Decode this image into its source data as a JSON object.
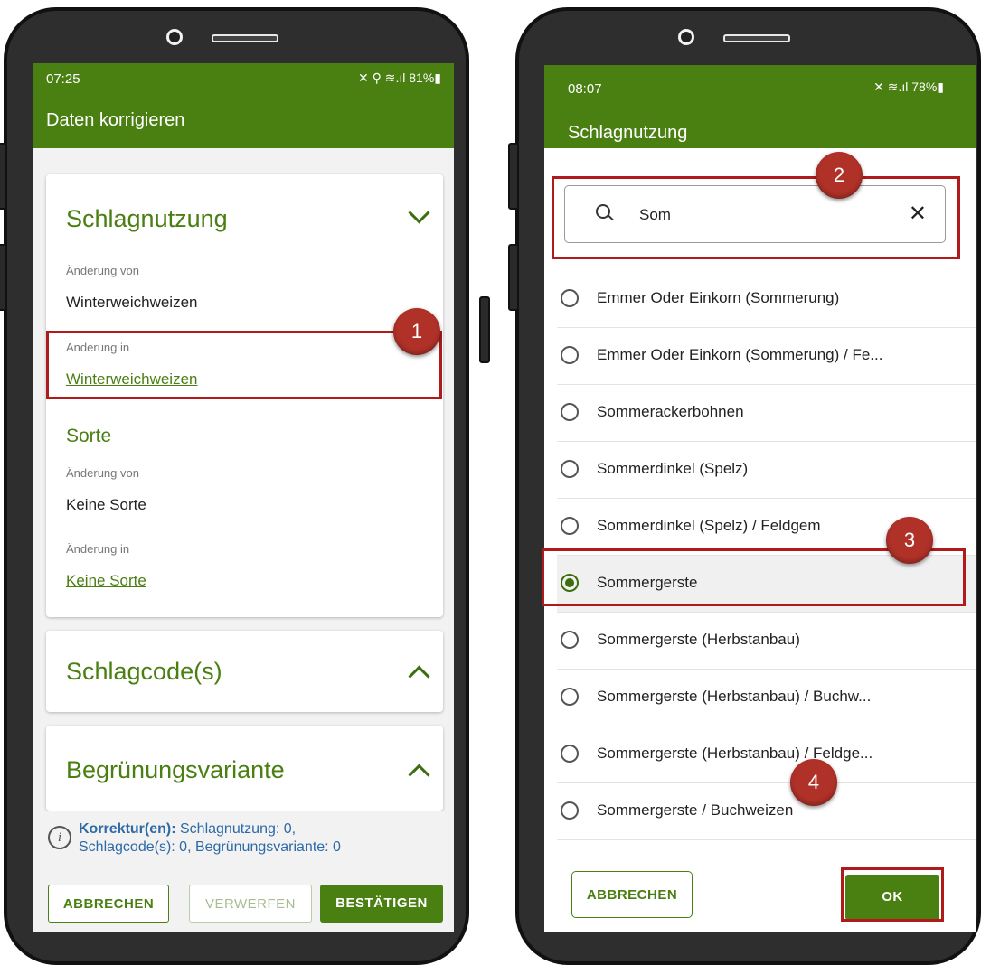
{
  "left_phone": {
    "status": {
      "time": "07:25",
      "icons": "✕ ⚲ ≋.ıl 81%▮"
    },
    "app_title": "Daten korrigieren",
    "card_schlagnutzung": {
      "title": "Schlagnutzung",
      "from_label": "Änderung von",
      "from_value": "Winterweichweizen",
      "to_label": "Änderung in",
      "to_value": "Winterweichweizen",
      "sorte_title": "Sorte",
      "sorte_from_label": "Änderung von",
      "sorte_from_value": "Keine Sorte",
      "sorte_to_label": "Änderung in",
      "sorte_to_value": "Keine Sorte"
    },
    "card_schlagcode": {
      "title": "Schlagcode(s)"
    },
    "card_begruenung": {
      "title": "Begrünungsvariante"
    },
    "info": {
      "bold": "Korrektur(en):",
      "text": " Schlagnutzung: 0,",
      "line2": "Schlagcode(s): 0,  Begrünungsvariante: 0"
    },
    "buttons": {
      "cancel": "ABBRECHEN",
      "discard": "VERWERFEN",
      "confirm": "BESTÄTIGEN"
    }
  },
  "right_phone": {
    "status": {
      "time": "08:07",
      "icons": "✕ ≋.ıl 78%▮"
    },
    "app_title": "Schlagnutzung",
    "search": {
      "value": "Som",
      "placeholder": ""
    },
    "options": [
      {
        "label": "Emmer Oder Einkorn (Sommerung)",
        "selected": false
      },
      {
        "label": "Emmer Oder Einkorn (Sommerung) / Fe...",
        "selected": false
      },
      {
        "label": "Sommerackerbohnen",
        "selected": false
      },
      {
        "label": "Sommerdinkel (Spelz)",
        "selected": false
      },
      {
        "label": "Sommerdinkel (Spelz) / Feldgem",
        "selected": false
      },
      {
        "label": "Sommergerste",
        "selected": true
      },
      {
        "label": "Sommergerste (Herbstanbau)",
        "selected": false
      },
      {
        "label": "Sommergerste (Herbstanbau) / Buchw...",
        "selected": false
      },
      {
        "label": "Sommergerste (Herbstanbau) / Feldge...",
        "selected": false
      },
      {
        "label": "Sommergerste / Buchweizen",
        "selected": false
      }
    ],
    "buttons": {
      "cancel": "ABBRECHEN",
      "ok": "OK"
    }
  },
  "markers": [
    "1",
    "2",
    "3",
    "4"
  ],
  "colors": {
    "primary": "#4a7f12",
    "highlight": "#b11a1a",
    "marker": "#b03128"
  }
}
